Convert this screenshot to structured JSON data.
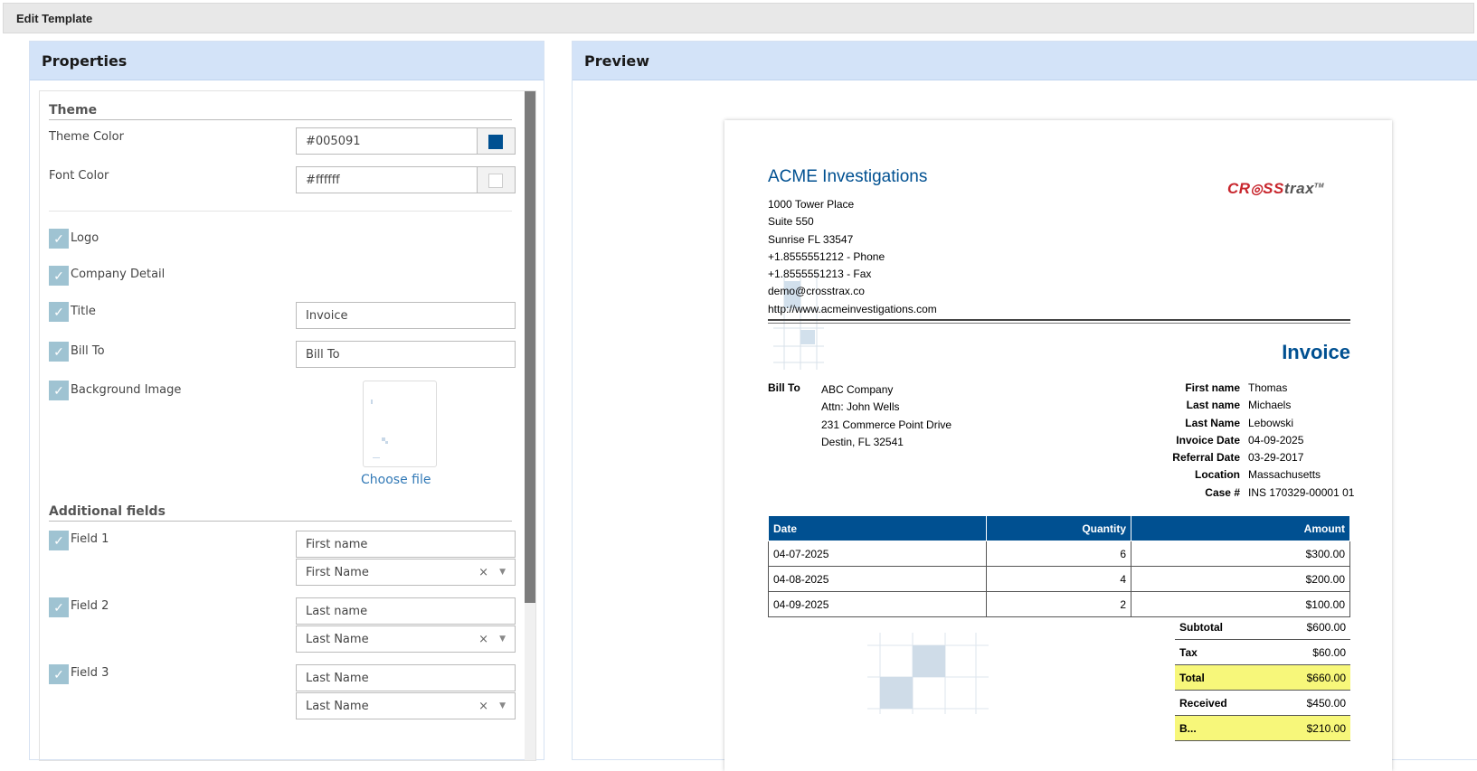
{
  "header": {
    "title": "Edit Template"
  },
  "properties": {
    "title": "Properties",
    "theme_section": "Theme",
    "theme_color_label": "Theme Color",
    "theme_color_value": "#005091",
    "font_color_label": "Font Color",
    "font_color_value": "#ffffff",
    "logo_label": "Logo",
    "company_detail_label": "Company Detail",
    "title_label": "Title",
    "title_value": "Invoice",
    "bill_to_label": "Bill To",
    "bill_to_value": "Bill To",
    "background_image_label": "Background Image",
    "choose_file": "Choose file",
    "additional_section": "Additional fields",
    "fields": [
      {
        "label": "Field 1",
        "text": "First name",
        "select": "First Name"
      },
      {
        "label": "Field 2",
        "text": "Last name",
        "select": "Last Name"
      },
      {
        "label": "Field 3",
        "text": "Last Name",
        "select": "Last Name"
      }
    ],
    "clear_glyph": "×",
    "arrow_glyph": "▼",
    "check_glyph": "✓"
  },
  "preview": {
    "title": "Preview",
    "company_name": "ACME Investigations",
    "address_lines": [
      "1000 Tower Place",
      "Suite 550",
      "Sunrise FL 33547",
      "+1.8555551212 - Phone",
      "+1.8555551213 - Fax",
      "demo@crosstrax.co",
      "http://www.acmeinvestigations.com"
    ],
    "logo_red": "CR",
    "logo_red2": "SS",
    "logo_grey": "trax",
    "logo_tm": "TM",
    "invoice_title": "Invoice",
    "bill_to_label": "Bill To",
    "bill_to_lines": [
      "ABC Company",
      "Attn: John Wells",
      "231 Commerce Point Drive",
      "Destin, FL 32541"
    ],
    "meta": [
      {
        "k": "First name",
        "v": "Thomas"
      },
      {
        "k": "Last name",
        "v": "Michaels"
      },
      {
        "k": "Last Name",
        "v": "Lebowski"
      },
      {
        "k": "Invoice Date",
        "v": "04-09-2025"
      },
      {
        "k": "Referral Date",
        "v": "03-29-2017"
      },
      {
        "k": "Location",
        "v": "Massachusetts"
      },
      {
        "k": "Case #",
        "v": "INS 170329-00001 01"
      }
    ],
    "table_headers": [
      "Date",
      "Quantity",
      "Amount"
    ],
    "rows": [
      [
        "04-07-2025",
        "6",
        "$300.00"
      ],
      [
        "04-08-2025",
        "4",
        "$200.00"
      ],
      [
        "04-09-2025",
        "2",
        "$100.00"
      ]
    ],
    "totals": [
      {
        "k": "Subtotal",
        "v": "$600.00"
      },
      {
        "k": "Tax",
        "v": "$60.00"
      },
      {
        "k": "Total",
        "v": "$660.00"
      },
      {
        "k": "Received",
        "v": "$450.00"
      },
      {
        "k": "B...",
        "v": "$210.00"
      }
    ]
  },
  "colors": {
    "theme": "#005091",
    "font": "#ffffff",
    "panel_header": "#d3e3f8",
    "checkbox": "#9fc3d2",
    "total_highlight": "#f7f77a",
    "logo_red": "#c8262d"
  }
}
